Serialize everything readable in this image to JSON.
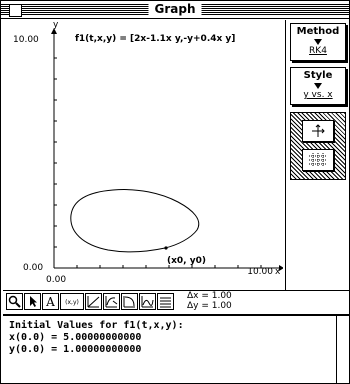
{
  "window": {
    "title": "Graph"
  },
  "plot": {
    "y_axis_label": "y",
    "x_axis_label": "x",
    "y_max_label": "10.00",
    "y_min_label": "0.00",
    "x_min_label": "0.00",
    "x_max_label": "10.00",
    "equation": "f1(t,x,y) = [2x-1.1x y,-y+0.4x y]",
    "point_label": "(x0, y0)"
  },
  "side_panel": {
    "method_label": "Method",
    "method_value": "RK4",
    "style_label": "Style",
    "style_value": "y vs. x"
  },
  "toolbar": {
    "icons": [
      "magnifier-icon",
      "arrow-icon",
      "text-a-icon",
      "xy-icon",
      "line-icon",
      "direction-field-icon",
      "curve-icon",
      "flow-icon",
      "grid-icon"
    ],
    "xy_label": "(x,y)",
    "dx": "Δx = 1.00",
    "dy": "Δy = 1.00"
  },
  "console": {
    "line1": "Initial Values for f1(t,x,y):",
    "line2": "x(0.0) = 5.00000000000",
    "line3": "y(0.0) = 1.00000000000"
  },
  "colors": {
    "foreground": "#000000",
    "background": "#ffffff"
  }
}
